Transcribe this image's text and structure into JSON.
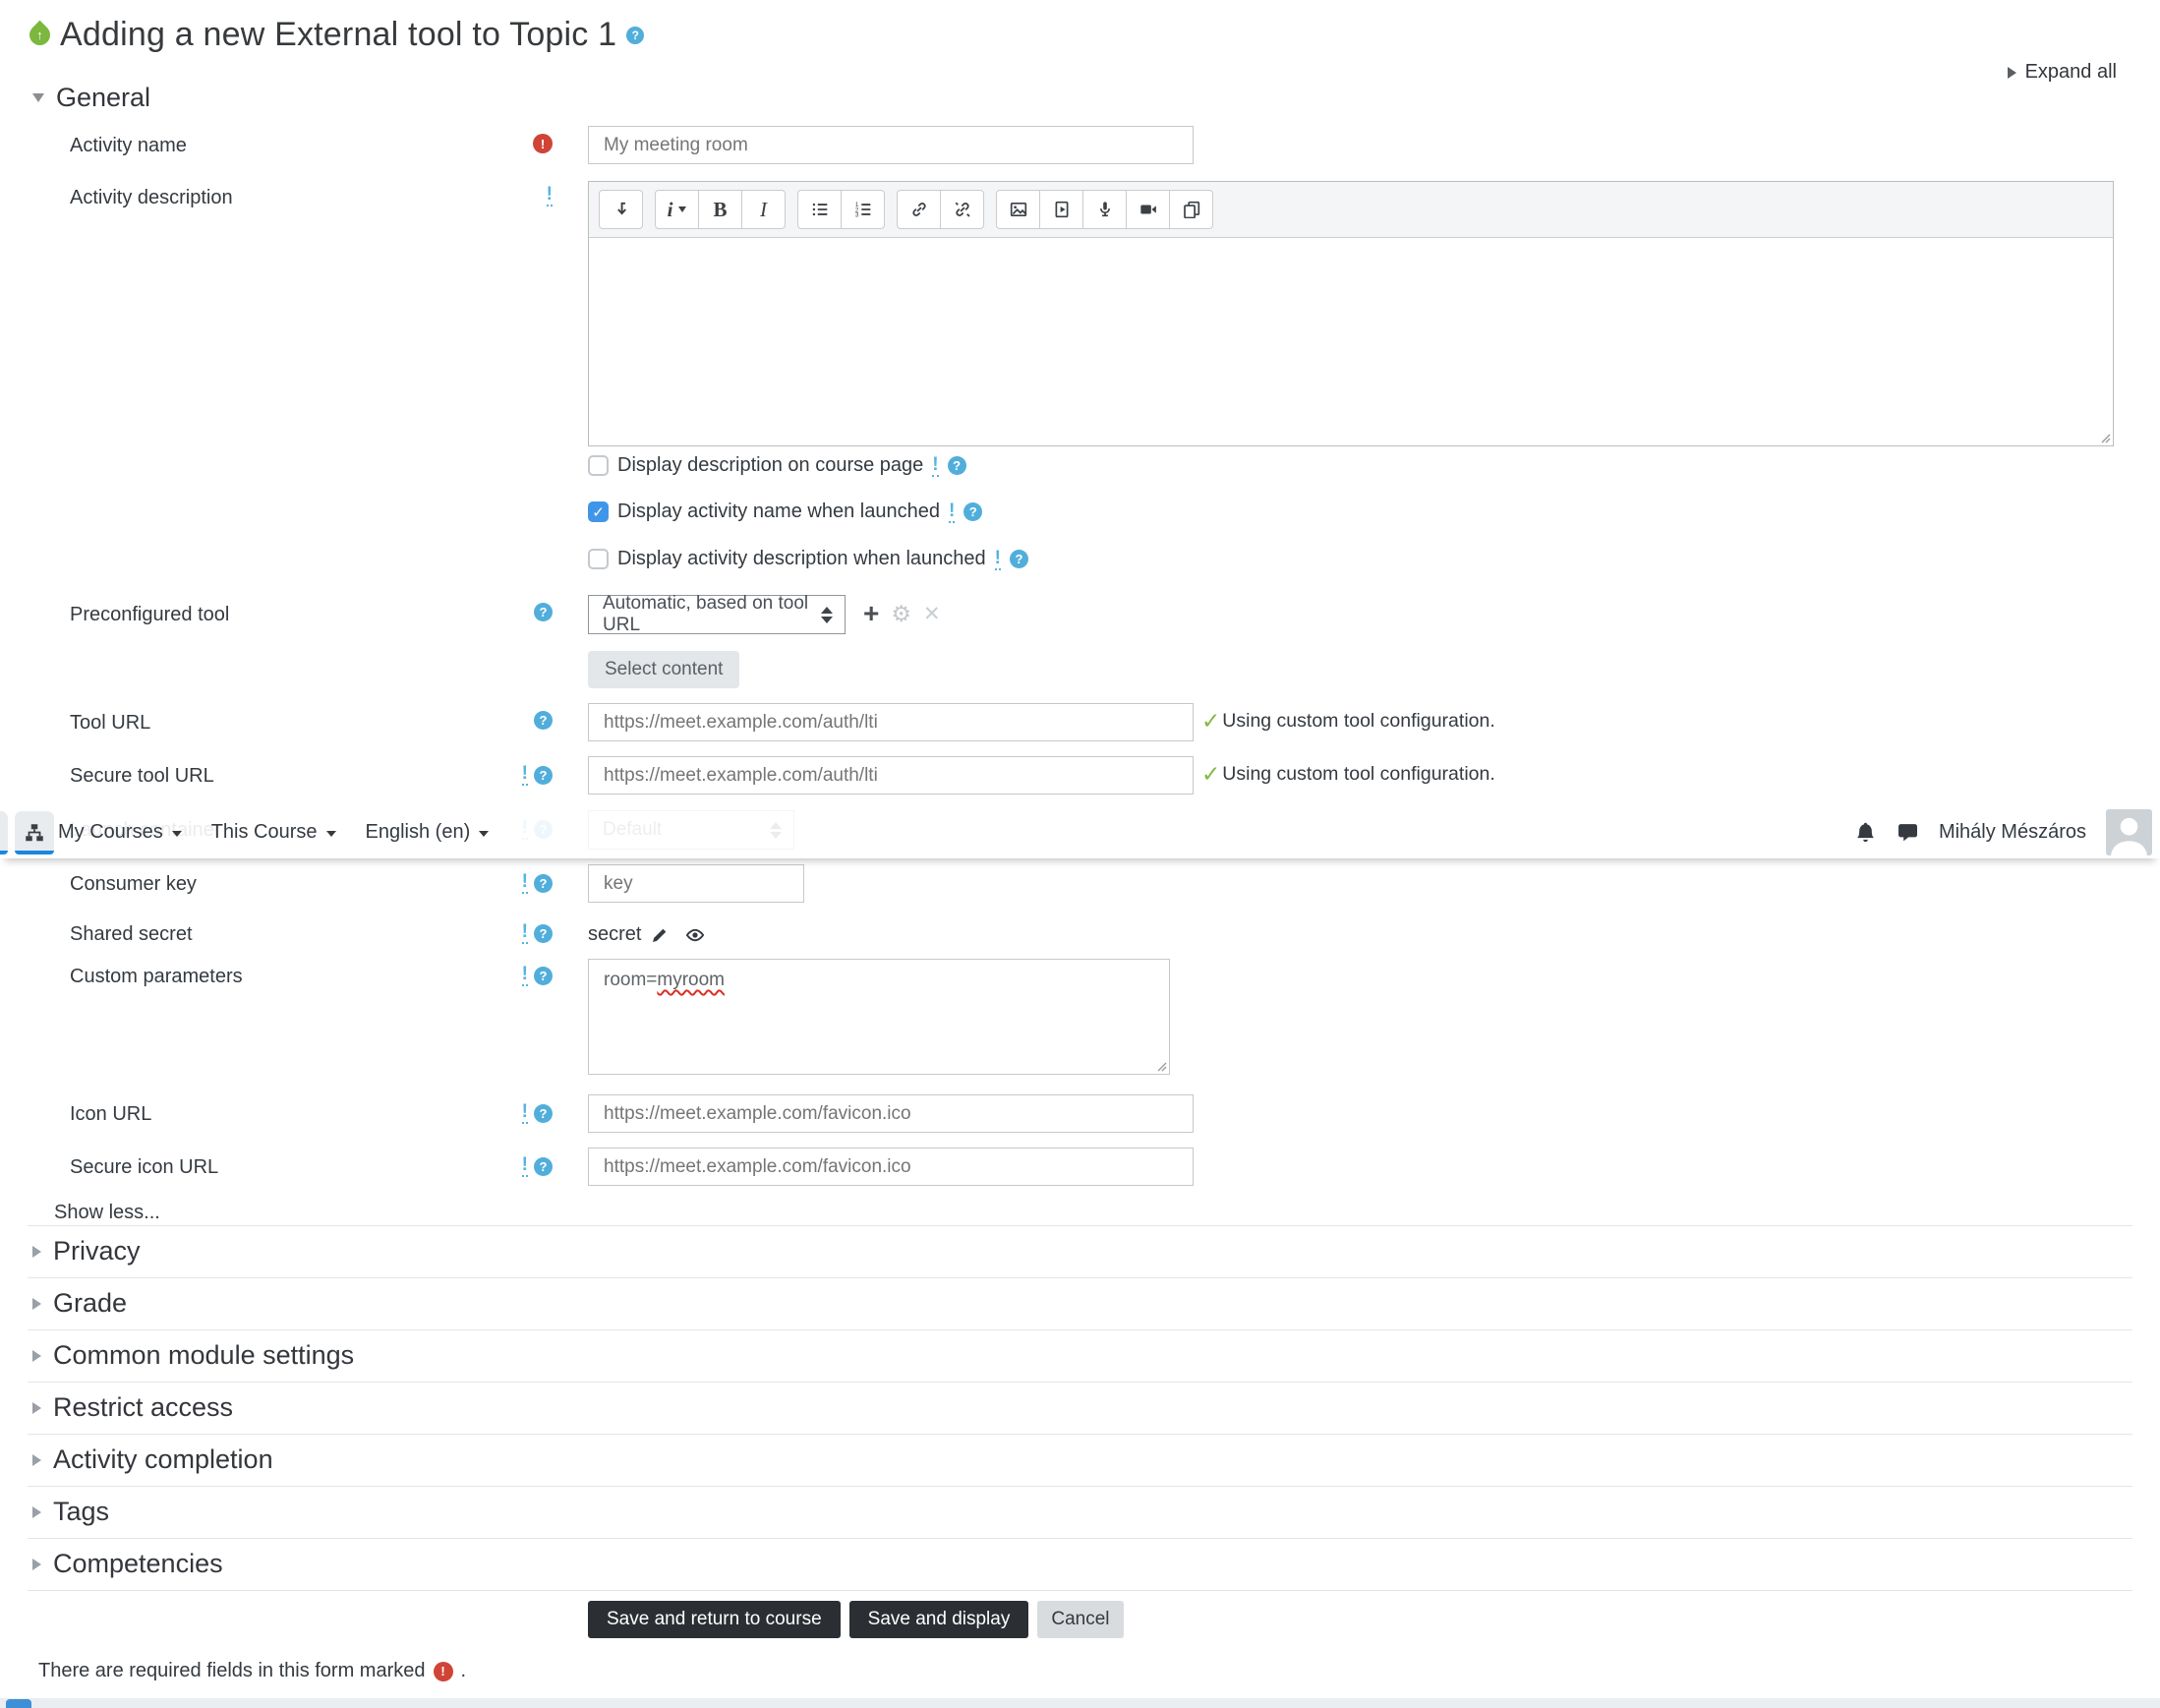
{
  "page": {
    "title": "Adding a new External tool to Topic 1",
    "expand_all": "Expand all",
    "show_less": "Show less...",
    "required_note": "There are required fields in this form marked",
    "required_note_end": "."
  },
  "glyphs": {
    "help": "?",
    "required": "!",
    "advanced": "!",
    "check": "✓",
    "up_arrow": "↑",
    "add": "+",
    "gear": "⚙",
    "close": "✕",
    "bold": "B",
    "italic": "I",
    "paragraph": "i"
  },
  "navbar": {
    "items": [
      {
        "label": "My Courses"
      },
      {
        "label": "This Course"
      },
      {
        "label": "English (en)"
      }
    ],
    "user_name": "Mihály Mészáros"
  },
  "sections": {
    "general": "General",
    "collapsed": [
      {
        "label": "Privacy"
      },
      {
        "label": "Grade"
      },
      {
        "label": "Common module settings"
      },
      {
        "label": "Restrict access"
      },
      {
        "label": "Activity completion"
      },
      {
        "label": "Tags"
      },
      {
        "label": "Competencies"
      }
    ]
  },
  "fields": {
    "activity_name": {
      "label": "Activity name",
      "value": "My meeting room",
      "required": true
    },
    "activity_description": {
      "label": "Activity description",
      "value": ""
    },
    "display_description": {
      "label": "Display description on course page",
      "checked": false
    },
    "display_activity_name": {
      "label": "Display activity name when launched",
      "checked": true
    },
    "display_activity_description": {
      "label": "Display activity description when launched",
      "checked": false
    },
    "preconfigured_tool": {
      "label": "Preconfigured tool",
      "value": "Automatic, based on tool URL"
    },
    "select_content": {
      "label": "Select content",
      "disabled": true
    },
    "tool_url": {
      "label": "Tool URL",
      "value": "https://meet.example.com/auth/lti",
      "status": "Using custom tool configuration."
    },
    "secure_tool_url": {
      "label": "Secure tool URL",
      "value": "https://meet.example.com/auth/lti",
      "status": "Using custom tool configuration."
    },
    "launch_container": {
      "label": "Launch container",
      "value": "Default"
    },
    "consumer_key": {
      "label": "Consumer key",
      "value": "key"
    },
    "shared_secret": {
      "label": "Shared secret",
      "value": "secret"
    },
    "custom_parameters": {
      "label": "Custom parameters",
      "value": "room=myroom",
      "value_prefix": "room=",
      "misspelled_word": "myroom"
    },
    "icon_url": {
      "label": "Icon URL",
      "value": "https://meet.example.com/favicon.ico"
    },
    "secure_icon_url": {
      "label": "Secure icon URL",
      "value": "https://meet.example.com/favicon.ico"
    }
  },
  "buttons": {
    "save_return": "Save and return to course",
    "save_display": "Save and display",
    "cancel": "Cancel"
  },
  "colors": {
    "help_icon": "#51aedb",
    "required_icon": "#d04437",
    "success_check": "#84b841",
    "checkbox_checked": "#3f96e8",
    "active_tab_underline": "#1b87e0",
    "primary_button": "#2b2f33",
    "activity_icon_green": "#7cb73e"
  }
}
